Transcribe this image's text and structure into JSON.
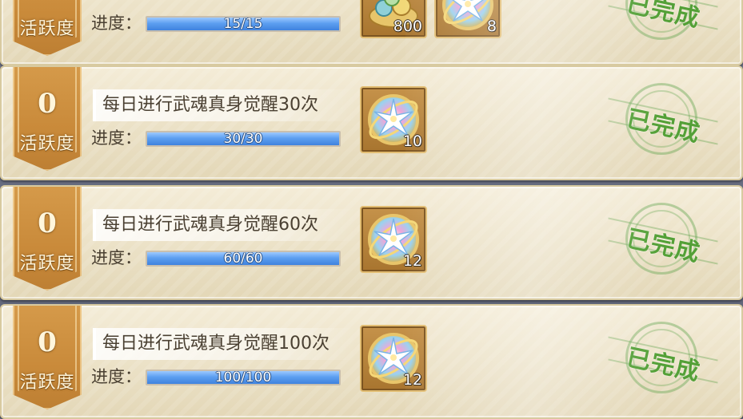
{
  "badge_label": "活跃度",
  "progress_label": "进度：",
  "status_completed": "已完成",
  "colors": {
    "bar_fill": "#4f8fe6",
    "stamp_green": "#54a037",
    "badge_orange": "#c98a3a"
  },
  "tasks": [
    {
      "points": "",
      "title": "",
      "progress_text": "15/15",
      "progress_fraction": 1.0,
      "rewards": [
        {
          "icon": "gem-pile-icon",
          "count": "800"
        },
        {
          "icon": "star-orb-icon",
          "count": "8"
        }
      ],
      "status": "已完成"
    },
    {
      "points": "0",
      "title": "每日进行武魂真身觉醒30次",
      "progress_text": "30/30",
      "progress_fraction": 1.0,
      "rewards": [
        {
          "icon": "star-orb-icon",
          "count": "10"
        }
      ],
      "status": "已完成"
    },
    {
      "points": "0",
      "title": "每日进行武魂真身觉醒60次",
      "progress_text": "60/60",
      "progress_fraction": 1.0,
      "rewards": [
        {
          "icon": "star-orb-icon",
          "count": "12"
        }
      ],
      "status": "已完成"
    },
    {
      "points": "0",
      "title": "每日进行武魂真身觉醒100次",
      "progress_text": "100/100",
      "progress_fraction": 1.0,
      "rewards": [
        {
          "icon": "star-orb-icon",
          "count": "12"
        }
      ],
      "status": "已完成"
    }
  ]
}
